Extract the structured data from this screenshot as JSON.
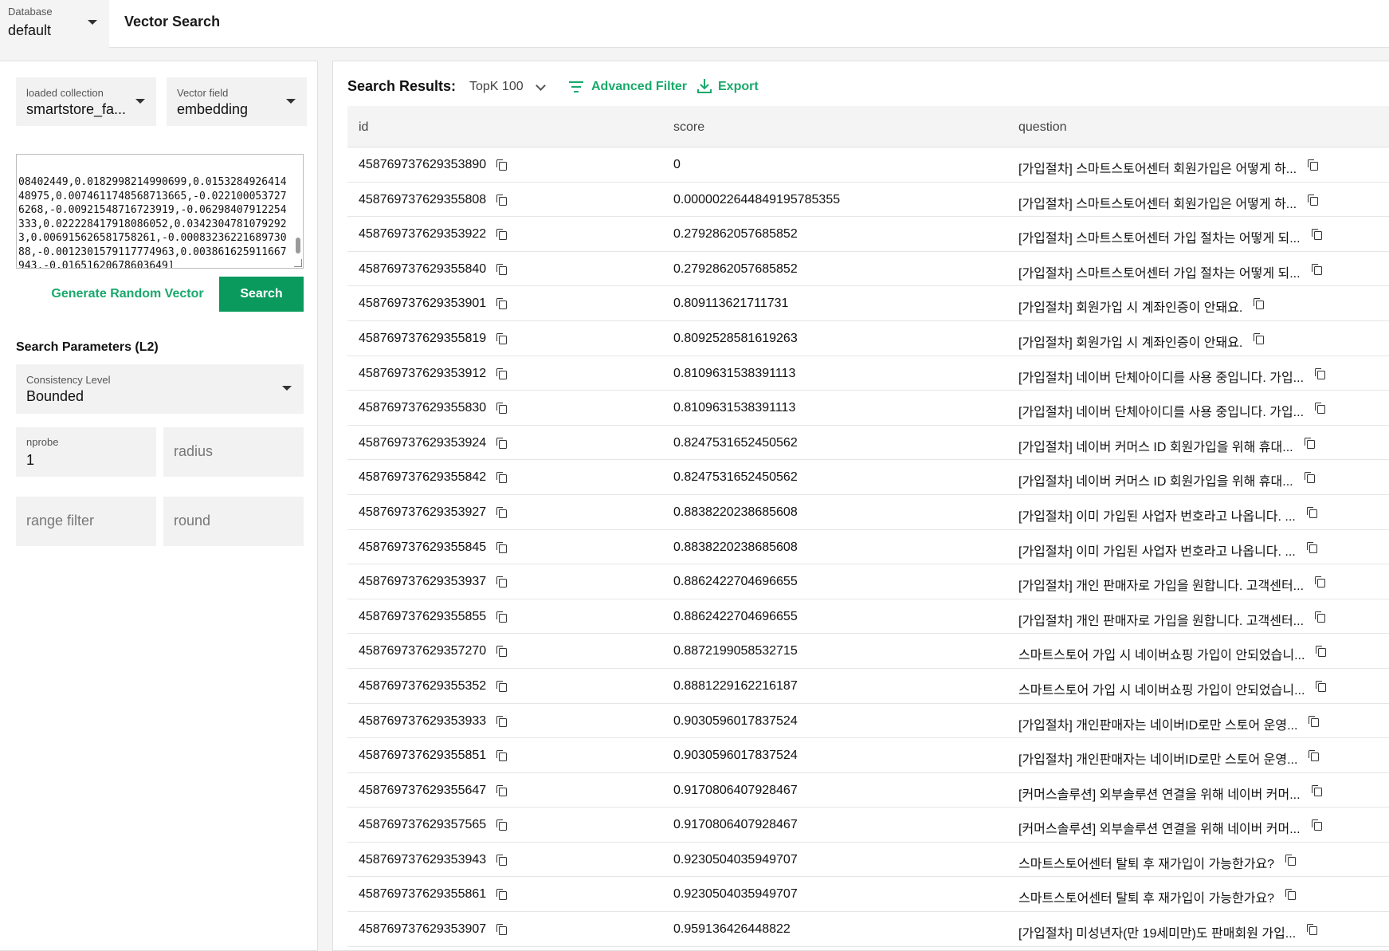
{
  "header": {
    "database_label": "Database",
    "database_value": "default",
    "title": "Vector Search"
  },
  "left": {
    "collection": {
      "label": "loaded collection",
      "value": "smartstore_fa..."
    },
    "vector_field": {
      "label": "Vector field",
      "value": "embedding"
    },
    "vector_text": "08402449,0.0182998214990699,0.015328492641448975,0.0074611748568713665,-0.0221000537276268,-0.00921548716723919,-0.06298407912254333,0.022228417918086052,0.03423047810792923,0.006915626581758261,-0.0008323622168973088,-0.0012301579117774963,0.003861625911667943,-0.01651620678603649]",
    "generate_label": "Generate Random Vector",
    "search_label": "Search",
    "params_title": "Search Parameters (L2)",
    "consistency": {
      "label": "Consistency Level",
      "value": "Bounded"
    },
    "nprobe": {
      "label": "nprobe",
      "value": "1"
    },
    "radius_placeholder": "radius",
    "range_filter_placeholder": "range filter",
    "round_placeholder": "round"
  },
  "results": {
    "label": "Search Results:",
    "topk": "TopK 100",
    "advanced_filter": "Advanced Filter",
    "export": "Export",
    "columns": [
      "id",
      "score",
      "question"
    ],
    "rows": [
      {
        "id": "458769737629353890",
        "score": "0",
        "question": "[가입절차] 스마트스토어센터 회원가입은 어떻게 하..."
      },
      {
        "id": "458769737629355808",
        "score": "0.0000022644849195785355",
        "question": "[가입절차] 스마트스토어센터 회원가입은 어떻게 하..."
      },
      {
        "id": "458769737629353922",
        "score": "0.2792862057685852",
        "question": "[가입절차] 스마트스토어센터 가입 절차는 어떻게 되..."
      },
      {
        "id": "458769737629355840",
        "score": "0.2792862057685852",
        "question": "[가입절차] 스마트스토어센터 가입 절차는 어떻게 되..."
      },
      {
        "id": "458769737629353901",
        "score": "0.809113621711731",
        "question": "[가입절차] 회원가입 시 계좌인증이 안돼요."
      },
      {
        "id": "458769737629355819",
        "score": "0.8092528581619263",
        "question": "[가입절차] 회원가입 시 계좌인증이 안돼요."
      },
      {
        "id": "458769737629353912",
        "score": "0.8109631538391113",
        "question": "[가입절차] 네이버 단체아이디를 사용 중입니다. 가입..."
      },
      {
        "id": "458769737629355830",
        "score": "0.8109631538391113",
        "question": "[가입절차] 네이버 단체아이디를 사용 중입니다. 가입..."
      },
      {
        "id": "458769737629353924",
        "score": "0.8247531652450562",
        "question": "[가입절차] 네이버 커머스 ID 회원가입을 위해 휴대..."
      },
      {
        "id": "458769737629355842",
        "score": "0.8247531652450562",
        "question": "[가입절차] 네이버 커머스 ID 회원가입을 위해 휴대..."
      },
      {
        "id": "458769737629353927",
        "score": "0.8838220238685608",
        "question": "[가입절차] 이미 가입된 사업자 번호라고 나옵니다. ..."
      },
      {
        "id": "458769737629355845",
        "score": "0.8838220238685608",
        "question": "[가입절차] 이미 가입된 사업자 번호라고 나옵니다. ..."
      },
      {
        "id": "458769737629353937",
        "score": "0.8862422704696655",
        "question": "[가입절차] 개인 판매자로 가입을 원합니다. 고객센터..."
      },
      {
        "id": "458769737629355855",
        "score": "0.8862422704696655",
        "question": "[가입절차] 개인 판매자로 가입을 원합니다. 고객센터..."
      },
      {
        "id": "458769737629357270",
        "score": "0.8872199058532715",
        "question": "스마트스토어 가입 시 네이버쇼핑 가입이 안되었습니..."
      },
      {
        "id": "458769737629355352",
        "score": "0.8881229162216187",
        "question": "스마트스토어 가입 시 네이버쇼핑 가입이 안되었습니..."
      },
      {
        "id": "458769737629353933",
        "score": "0.9030596017837524",
        "question": "[가입절차] 개인판매자는 네이버ID로만 스토어 운영..."
      },
      {
        "id": "458769737629355851",
        "score": "0.9030596017837524",
        "question": "[가입절차] 개인판매자는 네이버ID로만 스토어 운영..."
      },
      {
        "id": "458769737629355647",
        "score": "0.9170806407928467",
        "question": "[커머스솔루션] 외부솔루션 연결을 위해 네이버 커머..."
      },
      {
        "id": "458769737629357565",
        "score": "0.9170806407928467",
        "question": "[커머스솔루션] 외부솔루션 연결을 위해 네이버 커머..."
      },
      {
        "id": "458769737629353943",
        "score": "0.9230504035949707",
        "question": "스마트스토어센터 탈퇴 후 재가입이 가능한가요?"
      },
      {
        "id": "458769737629355861",
        "score": "0.9230504035949707",
        "question": "스마트스토어센터 탈퇴 후 재가입이 가능한가요?"
      },
      {
        "id": "458769737629353907",
        "score": "0.959136426448822",
        "question": "[가입절차] 미성년자(만 19세미만)도 판매회원 가입..."
      }
    ]
  },
  "colors": {
    "accent": "#18a96b",
    "primary_button": "#0b9a5e"
  }
}
